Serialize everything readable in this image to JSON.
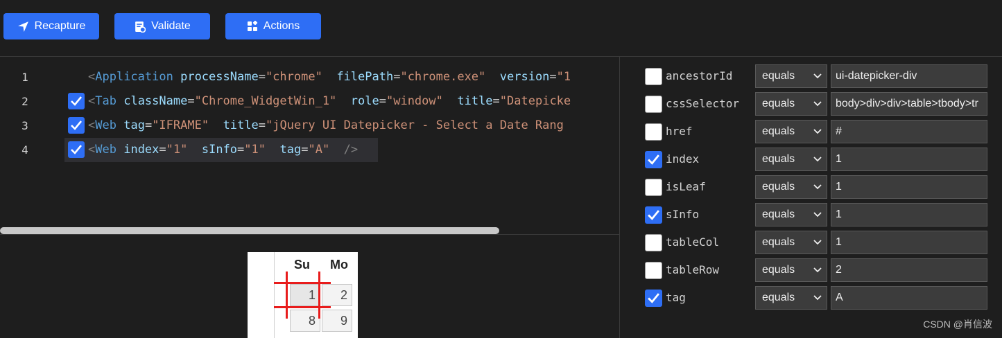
{
  "toolbar": {
    "recapture_label": "Recapture",
    "validate_label": "Validate",
    "actions_label": "Actions"
  },
  "editor": {
    "lines": [
      {
        "num": "1",
        "checked": false,
        "tag_open": "<",
        "tag": "Application",
        "attrs": [
          {
            "name": "processName",
            "value": "\"chrome\""
          },
          {
            "name": "filePath",
            "value": "\"chrome.exe\""
          },
          {
            "name": "version",
            "value": "\"1"
          }
        ],
        "close": ""
      },
      {
        "num": "2",
        "checked": true,
        "tag_open": "<",
        "tag": "Tab",
        "attrs": [
          {
            "name": "className",
            "value": "\"Chrome_WidgetWin_1\""
          },
          {
            "name": "role",
            "value": "\"window\""
          },
          {
            "name": "title",
            "value": "\"Datepicke"
          }
        ],
        "close": ""
      },
      {
        "num": "3",
        "checked": true,
        "tag_open": "<",
        "tag": "Web",
        "attrs": [
          {
            "name": "tag",
            "value": "\"IFRAME\""
          },
          {
            "name": "title",
            "value": "\"jQuery UI Datepicker - Select a Date Rang"
          }
        ],
        "close": ""
      },
      {
        "num": "4",
        "checked": true,
        "tag_open": "<",
        "tag": "Web",
        "attrs": [
          {
            "name": "index",
            "value": "\"1\""
          },
          {
            "name": "sInfo",
            "value": "\"1\""
          },
          {
            "name": "tag",
            "value": "\"A\""
          }
        ],
        "close": "/>"
      }
    ]
  },
  "preview": {
    "headers": [
      "Su",
      "Mo"
    ],
    "cells": [
      "1",
      "2",
      "8",
      "9"
    ]
  },
  "properties": [
    {
      "name": "ancestorId",
      "checked": false,
      "operator": "equals",
      "value": "ui-datepicker-div"
    },
    {
      "name": "cssSelector",
      "checked": false,
      "operator": "equals",
      "value": "body>div>div>table>tbody>tr"
    },
    {
      "name": "href",
      "checked": false,
      "operator": "equals",
      "value": "#"
    },
    {
      "name": "index",
      "checked": true,
      "operator": "equals",
      "value": "1"
    },
    {
      "name": "isLeaf",
      "checked": false,
      "operator": "equals",
      "value": "1"
    },
    {
      "name": "sInfo",
      "checked": true,
      "operator": "equals",
      "value": "1"
    },
    {
      "name": "tableCol",
      "checked": false,
      "operator": "equals",
      "value": "1"
    },
    {
      "name": "tableRow",
      "checked": false,
      "operator": "equals",
      "value": "2"
    },
    {
      "name": "tag",
      "checked": true,
      "operator": "equals",
      "value": "A"
    }
  ],
  "watermark": "CSDN @肖信波",
  "colors": {
    "accent": "#2e6ef5",
    "background": "#1e1e1e",
    "highlight_red": "#e81c1c"
  }
}
